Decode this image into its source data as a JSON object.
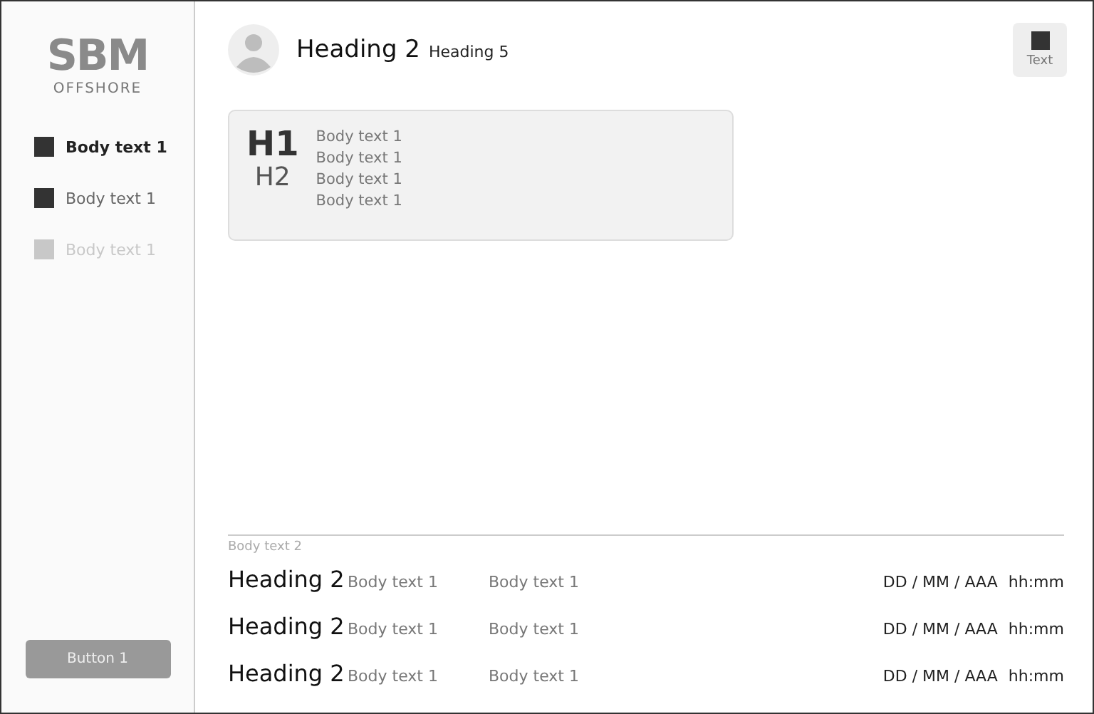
{
  "logo": {
    "mark": "SBM",
    "wordmark": "OFFSHORE"
  },
  "sidebar": {
    "items": [
      {
        "label": "Body text 1",
        "selected": true,
        "disabled": false
      },
      {
        "label": "Body text 1",
        "selected": false,
        "disabled": false
      },
      {
        "label": "Body text 1",
        "selected": false,
        "disabled": true
      }
    ],
    "button": "Button 1"
  },
  "header": {
    "title": "Heading 2",
    "subtitle": "Heading 5",
    "action": "Text"
  },
  "card": {
    "h1": "H1",
    "h2": "H2",
    "lines": [
      "Body text 1",
      "Body text 1",
      "Body text 1",
      "Body text 1"
    ]
  },
  "list": {
    "caption": "Body text 2",
    "rows": [
      {
        "heading": "Heading 2",
        "text": "Body text 1",
        "column_3": "Body text 1",
        "date": "DD / MM / AAA",
        "time": "hh:mm"
      },
      {
        "heading": "Heading 2",
        "text": "Body text 1",
        "column_3": "Body text 1",
        "date": "DD / MM / AAA",
        "time": "hh:mm"
      },
      {
        "heading": "Heading 2",
        "text": "Body text 1",
        "column_3": "Body text 1",
        "date": "DD / MM / AAA",
        "time": "hh:mm"
      }
    ]
  }
}
